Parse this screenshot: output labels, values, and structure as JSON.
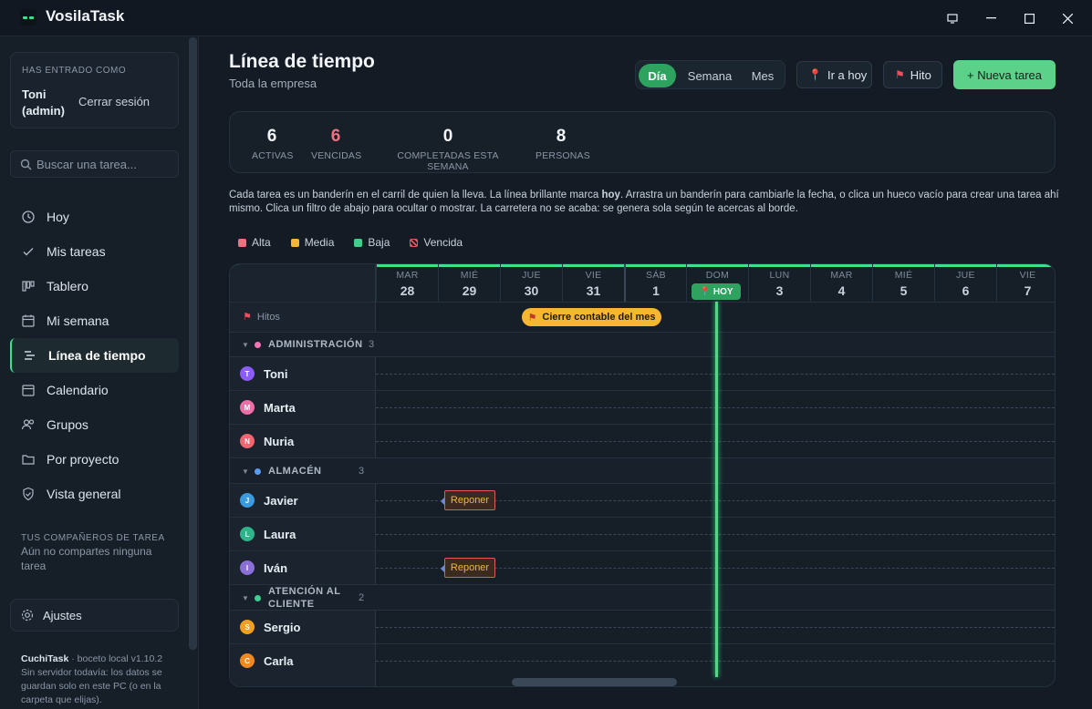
{
  "app": {
    "title": "VosilaTask"
  },
  "window_buttons": [
    "▭",
    "—",
    "☐",
    "✕"
  ],
  "user": {
    "label": "HAS ENTRADO COMO",
    "name": "Toni (admin)",
    "logout": "Cerrar sesión"
  },
  "search": {
    "placeholder": "Buscar una tarea..."
  },
  "nav": [
    {
      "label": "Hoy",
      "icon": "clock-icon"
    },
    {
      "label": "Mis tareas",
      "icon": "check-icon"
    },
    {
      "label": "Tablero",
      "icon": "board-icon"
    },
    {
      "label": "Mi semana",
      "icon": "calendar-week-icon"
    },
    {
      "label": "Línea de tiempo",
      "icon": "timeline-icon",
      "active": true
    },
    {
      "label": "Calendario",
      "icon": "calendar-icon"
    },
    {
      "label": "Grupos",
      "icon": "users-icon"
    },
    {
      "label": "Por proyecto",
      "icon": "folder-icon"
    },
    {
      "label": "Vista general",
      "icon": "shield-icon"
    }
  ],
  "companions": {
    "label": "TUS COMPAÑEROS DE TAREA",
    "text": "Aún no compartes ninguna tarea"
  },
  "settings": {
    "label": "Ajustes"
  },
  "footer": {
    "brand": "CuchiTask",
    "version": " · boceto local v1.10.2",
    "text": "Sin servidor todavía: los datos se guardan solo en este PC (o en la carpeta que elijas)."
  },
  "page": {
    "title": "Línea de tiempo",
    "subtitle": "Toda la empresa"
  },
  "view_modes": [
    "Día",
    "Semana",
    "Mes"
  ],
  "toolbar": {
    "go_today": "Ir a hoy",
    "milestone": "Hito",
    "new_task": "+ Nueva tarea"
  },
  "stats": [
    {
      "value": "6",
      "label": "ACTIVAS"
    },
    {
      "value": "6",
      "label": "VENCIDAS"
    },
    {
      "value": "0",
      "label": "COMPLETADAS ESTA SEMANA"
    },
    {
      "value": "8",
      "label": "PERSONAS"
    }
  ],
  "description_pre": "Cada tarea es un banderín en el carril de quien la lleva. La línea brillante marca ",
  "description_bold": "hoy",
  "description_post": ". Arrastra un banderín para cambiarle la fecha, o clica un hueco vacío para crear una tarea ahí mismo. Clica un filtro de abajo para ocultar o mostrar. La carretera no se acaba: se genera sola según te acercas al borde.",
  "legend": [
    {
      "label": "Alta",
      "color": "#f0707f"
    },
    {
      "label": "Media",
      "color": "#f5b731"
    },
    {
      "label": "Baja",
      "color": "#3ecf8e"
    },
    {
      "label": "Vencida",
      "color": "#e05a5a"
    }
  ],
  "days": [
    {
      "name": "MAR",
      "num": "28"
    },
    {
      "name": "MIÉ",
      "num": "29"
    },
    {
      "name": "JUE",
      "num": "30"
    },
    {
      "name": "VIE",
      "num": "31"
    },
    {
      "name": "SÁB",
      "num": "1"
    },
    {
      "name": "DOM",
      "num": ""
    },
    {
      "name": "LUN",
      "num": "3"
    },
    {
      "name": "MAR",
      "num": "4"
    },
    {
      "name": "MIÉ",
      "num": "5"
    },
    {
      "name": "JUE",
      "num": "6"
    },
    {
      "name": "VIE",
      "num": "7"
    }
  ],
  "today_label": "HOY",
  "milestones_label": "Hitos",
  "milestone": "Cierre contable del mes",
  "groups": [
    {
      "name": "ADMINISTRACIÓN",
      "count": "3",
      "color": "#f075b5",
      "people": [
        {
          "name": "Toni",
          "initial": "T",
          "color": "#8b5cf6"
        },
        {
          "name": "Marta",
          "initial": "M",
          "color": "#ec6fa9"
        },
        {
          "name": "Nuria",
          "initial": "N",
          "color": "#f06570"
        }
      ]
    },
    {
      "name": "ALMACÉN",
      "count": "3",
      "color": "#5b9cf0",
      "people": [
        {
          "name": "Javier",
          "initial": "J",
          "color": "#3b9be0"
        },
        {
          "name": "Laura",
          "initial": "L",
          "color": "#2fb48a"
        },
        {
          "name": "Iván",
          "initial": "I",
          "color": "#8b6fd6"
        }
      ]
    },
    {
      "name": "ATENCIÓN AL CLIENTE",
      "count": "2",
      "color": "#3ecf8e",
      "people": [
        {
          "name": "Sergio",
          "initial": "S",
          "color": "#f0a020"
        },
        {
          "name": "Carla",
          "initial": "C",
          "color": "#f08a20"
        }
      ]
    }
  ],
  "tasks": [
    {
      "label": "Reponer",
      "lane": "Javier"
    },
    {
      "label": "Reponer",
      "lane": "Iván"
    }
  ]
}
